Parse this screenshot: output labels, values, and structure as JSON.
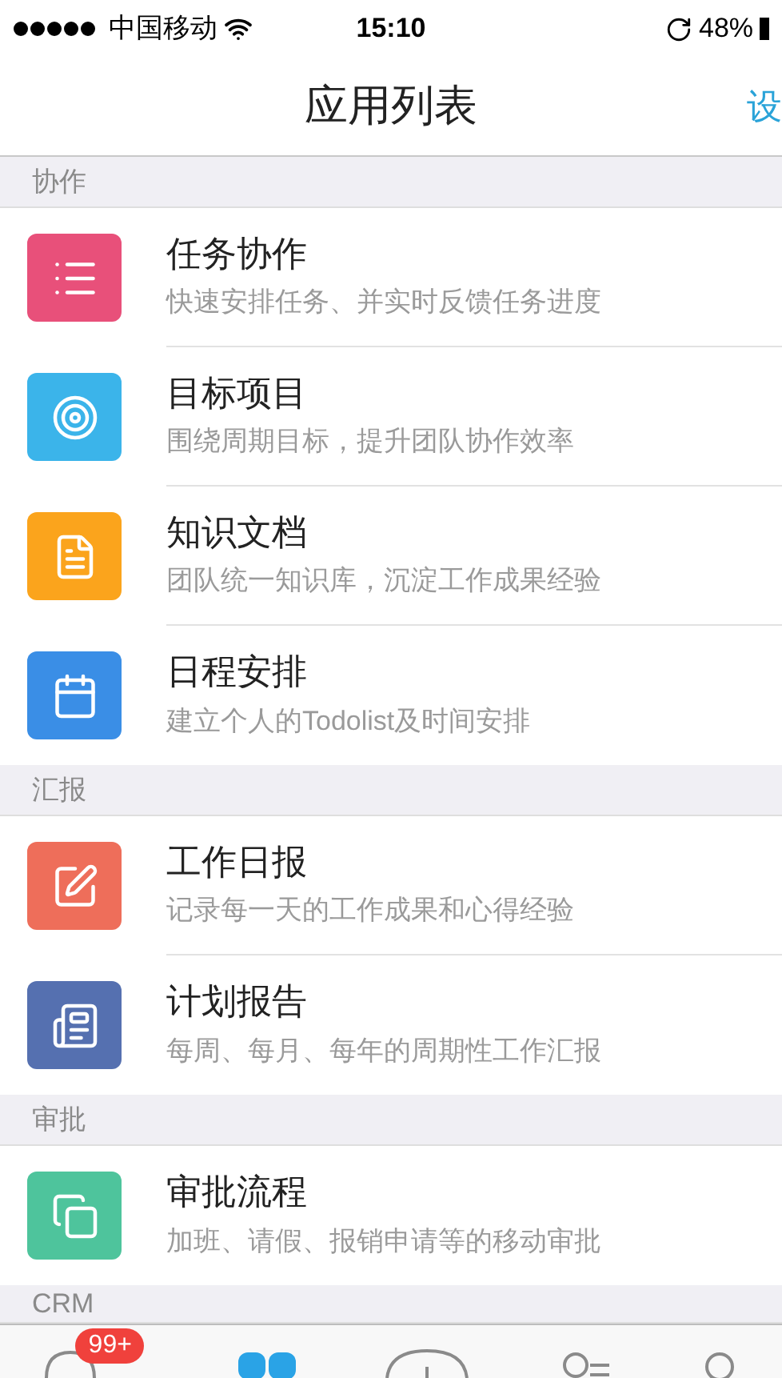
{
  "status_bar": {
    "carrier": "中国移动",
    "time": "15:10",
    "battery": "48%"
  },
  "nav_bar": {
    "title": "应用列表",
    "action": "设"
  },
  "sections": [
    {
      "title": "协作",
      "items": [
        {
          "kind": "tasks",
          "color": "#e8507a",
          "name": "任务协作",
          "description": "快速安排任务、并实时反馈任务进度"
        },
        {
          "kind": "goals",
          "color": "#3bb4ea",
          "name": "目标项目",
          "description": "围绕周期目标，提升团队协作效率"
        },
        {
          "kind": "docs",
          "color": "#fba41c",
          "name": "知识文档",
          "description": "团队统一知识库，沉淀工作成果经验"
        },
        {
          "kind": "calendar",
          "color": "#3a8ee6",
          "name": "日程安排",
          "description": "建立个人的Todolist及时间安排"
        }
      ]
    },
    {
      "title": "汇报",
      "items": [
        {
          "kind": "edit",
          "color": "#ee6e5a",
          "name": "工作日报",
          "description": "记录每一天的工作成果和心得经验"
        },
        {
          "kind": "report",
          "color": "#5570b0",
          "name": "计划报告",
          "description": "每周、每月、每年的周期性工作汇报"
        }
      ]
    },
    {
      "title": "审批",
      "items": [
        {
          "kind": "approval",
          "color": "#4ec49c",
          "name": "审批流程",
          "description": "加班、请假、报销申请等的移动审批"
        }
      ]
    },
    {
      "title": "CRM"
    }
  ],
  "tab_bar": [
    {
      "kind": "chat",
      "selected": false,
      "badge": "99+"
    },
    {
      "kind": "apps",
      "selected": true
    },
    {
      "kind": "add",
      "selected": false
    },
    {
      "kind": "contacts",
      "selected": false
    },
    {
      "kind": "me",
      "selected": false
    }
  ]
}
